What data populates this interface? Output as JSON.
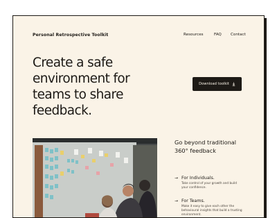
{
  "header": {
    "brand": "Personal Retrospective Toolkit",
    "nav": [
      "Resources",
      "FAQ",
      "Contact"
    ]
  },
  "hero": {
    "title": "Create a safe environment for teams to share feedback."
  },
  "cta": {
    "label": "Download toolkit",
    "icon": "download-icon"
  },
  "features": {
    "title": "Go beyond traditional 360° feedback",
    "items": [
      {
        "title": "For Individuals.",
        "description": "Take control of your growth and build your confidence."
      },
      {
        "title": "For Teams.",
        "description": "Make it easy to give each other the behavioural insights that build a trusting environment."
      }
    ]
  },
  "colors": {
    "background": "#faf3e7",
    "ink": "#1d1a16",
    "button": "#1d1a16",
    "button_text": "#faf3e7"
  }
}
